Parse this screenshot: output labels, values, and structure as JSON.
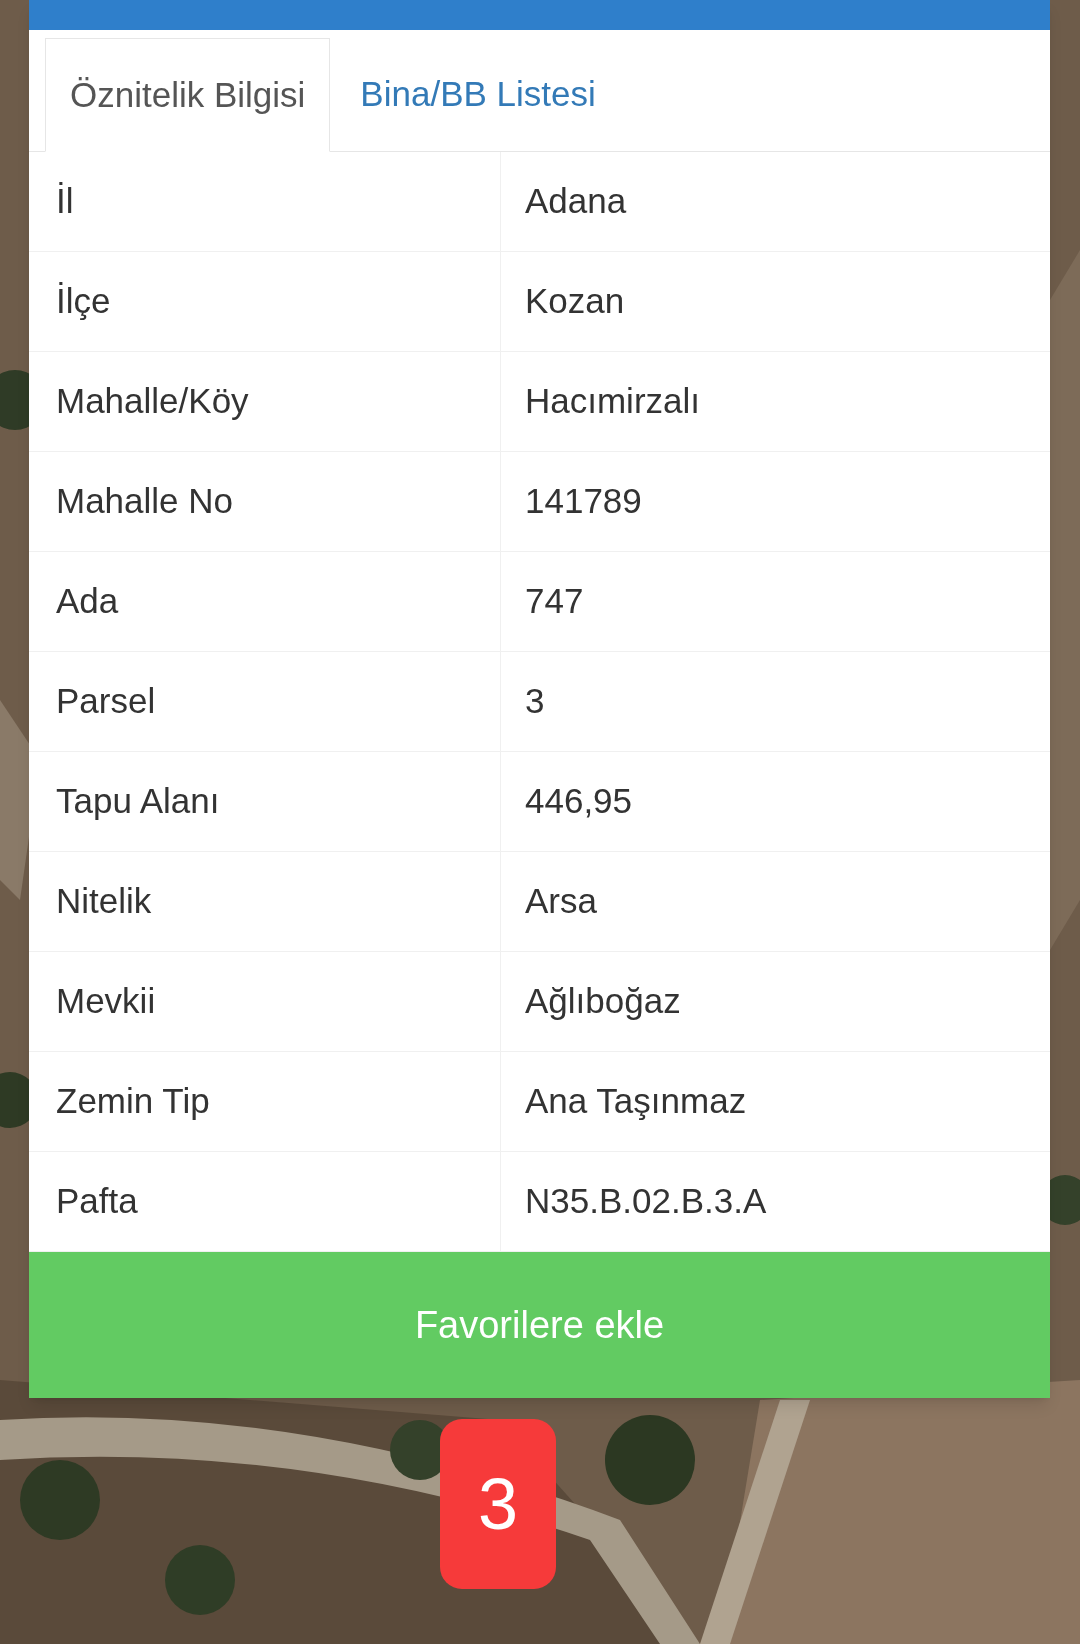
{
  "tabs": [
    {
      "label": "Öznitelik Bilgisi",
      "selected": true
    },
    {
      "label": "Bina/BB Listesi",
      "selected": false
    }
  ],
  "rows": [
    {
      "label": "İl",
      "value": "Adana"
    },
    {
      "label": "İlçe",
      "value": "Kozan"
    },
    {
      "label": "Mahalle/Köy",
      "value": "Hacımirzalı"
    },
    {
      "label": "Mahalle No",
      "value": "141789"
    },
    {
      "label": "Ada",
      "value": "747"
    },
    {
      "label": "Parsel",
      "value": "3"
    },
    {
      "label": "Tapu Alanı",
      "value": "446,95"
    },
    {
      "label": "Nitelik",
      "value": "Arsa"
    },
    {
      "label": "Mevkii",
      "value": "Ağlıboğaz"
    },
    {
      "label": "Zemin Tip",
      "value": "Ana Taşınmaz"
    },
    {
      "label": "Pafta",
      "value": "N35.B.02.B.3.A"
    }
  ],
  "button": {
    "label": "Favorilere ekle"
  },
  "marker": {
    "label": "3"
  }
}
